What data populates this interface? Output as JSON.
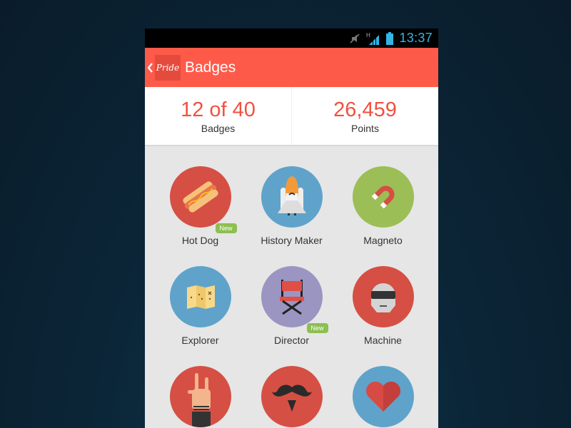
{
  "status_bar": {
    "time": "13:37",
    "icons": [
      "mute-icon",
      "signal-h-icon",
      "battery-icon"
    ]
  },
  "app_bar": {
    "back_icon": "chevron-left-icon",
    "logo_text": "Pride",
    "title": "Badges"
  },
  "stats": [
    {
      "value": "12 of 40",
      "label": "Badges"
    },
    {
      "value": "26,459",
      "label": "Points"
    }
  ],
  "colors": {
    "accent": "#fe5a4a",
    "stat_number": "#f15141",
    "status_time": "#33b5e5",
    "new_badge": "#8dbf51"
  },
  "badges": [
    {
      "name": "Hot Dog",
      "icon": "hot-dog-icon",
      "color": "#d64f44",
      "is_new": true,
      "new_label": "New"
    },
    {
      "name": "History Maker",
      "icon": "space-shuttle-icon",
      "color": "#5fa3cb",
      "is_new": false
    },
    {
      "name": "Magneto",
      "icon": "magnet-icon",
      "color": "#9cbe56",
      "is_new": false
    },
    {
      "name": "Explorer",
      "icon": "treasure-map-icon",
      "color": "#5fa3cb",
      "is_new": false
    },
    {
      "name": "Director",
      "icon": "director-chair-icon",
      "color": "#9b95c2",
      "is_new": true,
      "new_label": "New"
    },
    {
      "name": "Machine",
      "icon": "robot-helmet-icon",
      "color": "#d64f44",
      "is_new": false
    },
    {
      "name": "",
      "icon": "rock-hand-icon",
      "color": "#d64f44",
      "is_new": false
    },
    {
      "name": "",
      "icon": "mustache-icon",
      "color": "#d64f44",
      "is_new": false
    },
    {
      "name": "",
      "icon": "heart-icon",
      "color": "#5fa3cb",
      "is_new": false
    }
  ]
}
